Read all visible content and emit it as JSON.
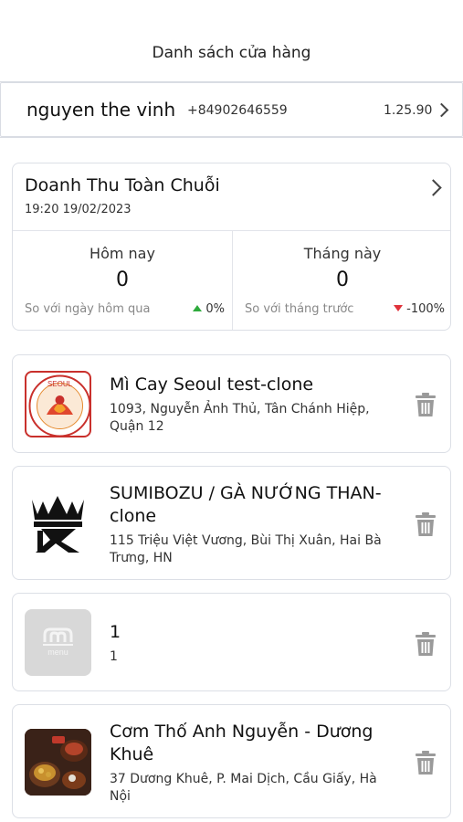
{
  "header": {
    "title": "Danh sách cửa hàng"
  },
  "user": {
    "name": "nguyen the vinh",
    "phone": "+84902646559",
    "version": "1.25.90"
  },
  "revenue": {
    "title": "Doanh Thu Toàn Chuỗi",
    "timestamp": "19:20 19/02/2023",
    "today": {
      "label": "Hôm nay",
      "value": "0",
      "compare_label": "So với ngày hôm qua",
      "change": "0%",
      "trend": "up"
    },
    "month": {
      "label": "Tháng này",
      "value": "0",
      "compare_label": "So với tháng trước",
      "change": "-100%",
      "trend": "down"
    }
  },
  "stores": [
    {
      "name": "Mì Cay Seoul test-clone",
      "address": "1093, Nguyễn Ảnh Thủ, Tân Chánh Hiệp, Quận 12",
      "logo": "seoul-logo-icon",
      "logo_text": "SEOUL"
    },
    {
      "name": "SUMIBOZU / GÀ NƯỚNG THAN-clone",
      "address": "115 Triệu Việt Vương, Bùi Thị Xuân, Hai Bà Trưng, HN",
      "logo": "sumibozu-logo-icon"
    },
    {
      "name": "1",
      "address": "1",
      "logo": "menu-placeholder-icon",
      "logo_text": "menu"
    },
    {
      "name": "Cơm Thố Anh Nguyễn - Dương Khuê",
      "address": "37 Dương Khuê, P. Mai Dịch, Cầu Giấy, Hà Nội",
      "logo": "food-photo-icon"
    }
  ],
  "colors": {
    "up": "#2eaa3c",
    "down": "#e0323b",
    "border": "#dcdfe6",
    "trash": "#9a9a9a"
  }
}
